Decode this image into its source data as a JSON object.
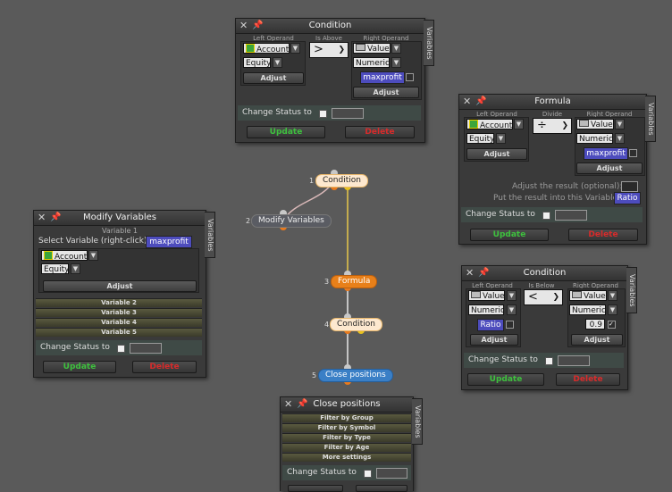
{
  "flow": {
    "nodes": [
      {
        "num": "1",
        "label": "Condition"
      },
      {
        "num": "2",
        "label": "Modify Variables"
      },
      {
        "num": "3",
        "label": "Formula"
      },
      {
        "num": "4",
        "label": "Condition"
      },
      {
        "num": "5",
        "label": "Close positions"
      }
    ]
  },
  "common": {
    "change_status": "Change Status to",
    "update": "Update",
    "delete": "Delete",
    "adjust": "Adjust",
    "variables_tab": "Variables",
    "close_icon": "close-icon",
    "pin_icon": "pin-icon"
  },
  "condition1": {
    "title": "Condition",
    "left_header": "Left Operand",
    "mid_header": "Is Above",
    "right_header": "Right Operand",
    "left_select": "Account",
    "left_sub": "Equity",
    "operator": ">",
    "right_select": "Value",
    "right_sub": "Numeric",
    "right_var": "maxprofit"
  },
  "formula": {
    "title": "Formula",
    "left_header": "Left Operand",
    "mid_header": "Divide",
    "right_header": "Right Operand",
    "left_select": "Account",
    "left_sub": "Equity",
    "operator": "÷",
    "right_select": "Value",
    "right_sub": "Numeric",
    "right_var": "maxprofit",
    "adjust_result": "Adjust the result (optional):",
    "put_result": "Put the result into this Variable:",
    "result_var": "Ratio"
  },
  "modify": {
    "title": "Modify Variables",
    "variable1": "Variable 1",
    "select_label": "Select Variable (right-click)",
    "var_name": "maxprofit",
    "source_select": "Account",
    "source_sub": "Equity",
    "variables": [
      "Variable 2",
      "Variable 3",
      "Variable 4",
      "Variable 5"
    ]
  },
  "condition2": {
    "title": "Condition",
    "left_header": "Left Operand",
    "mid_header": "Is Below",
    "right_header": "Right Operand",
    "left_select": "Value",
    "left_sub": "Numeric",
    "left_var": "Ratio",
    "operator": "<",
    "right_select": "Value",
    "right_sub": "Numeric",
    "right_value": "0.9"
  },
  "close": {
    "title": "Close positions",
    "filters": [
      "Filter by Group",
      "Filter by Symbol",
      "Filter by Type",
      "Filter by Age",
      "More settings"
    ]
  }
}
